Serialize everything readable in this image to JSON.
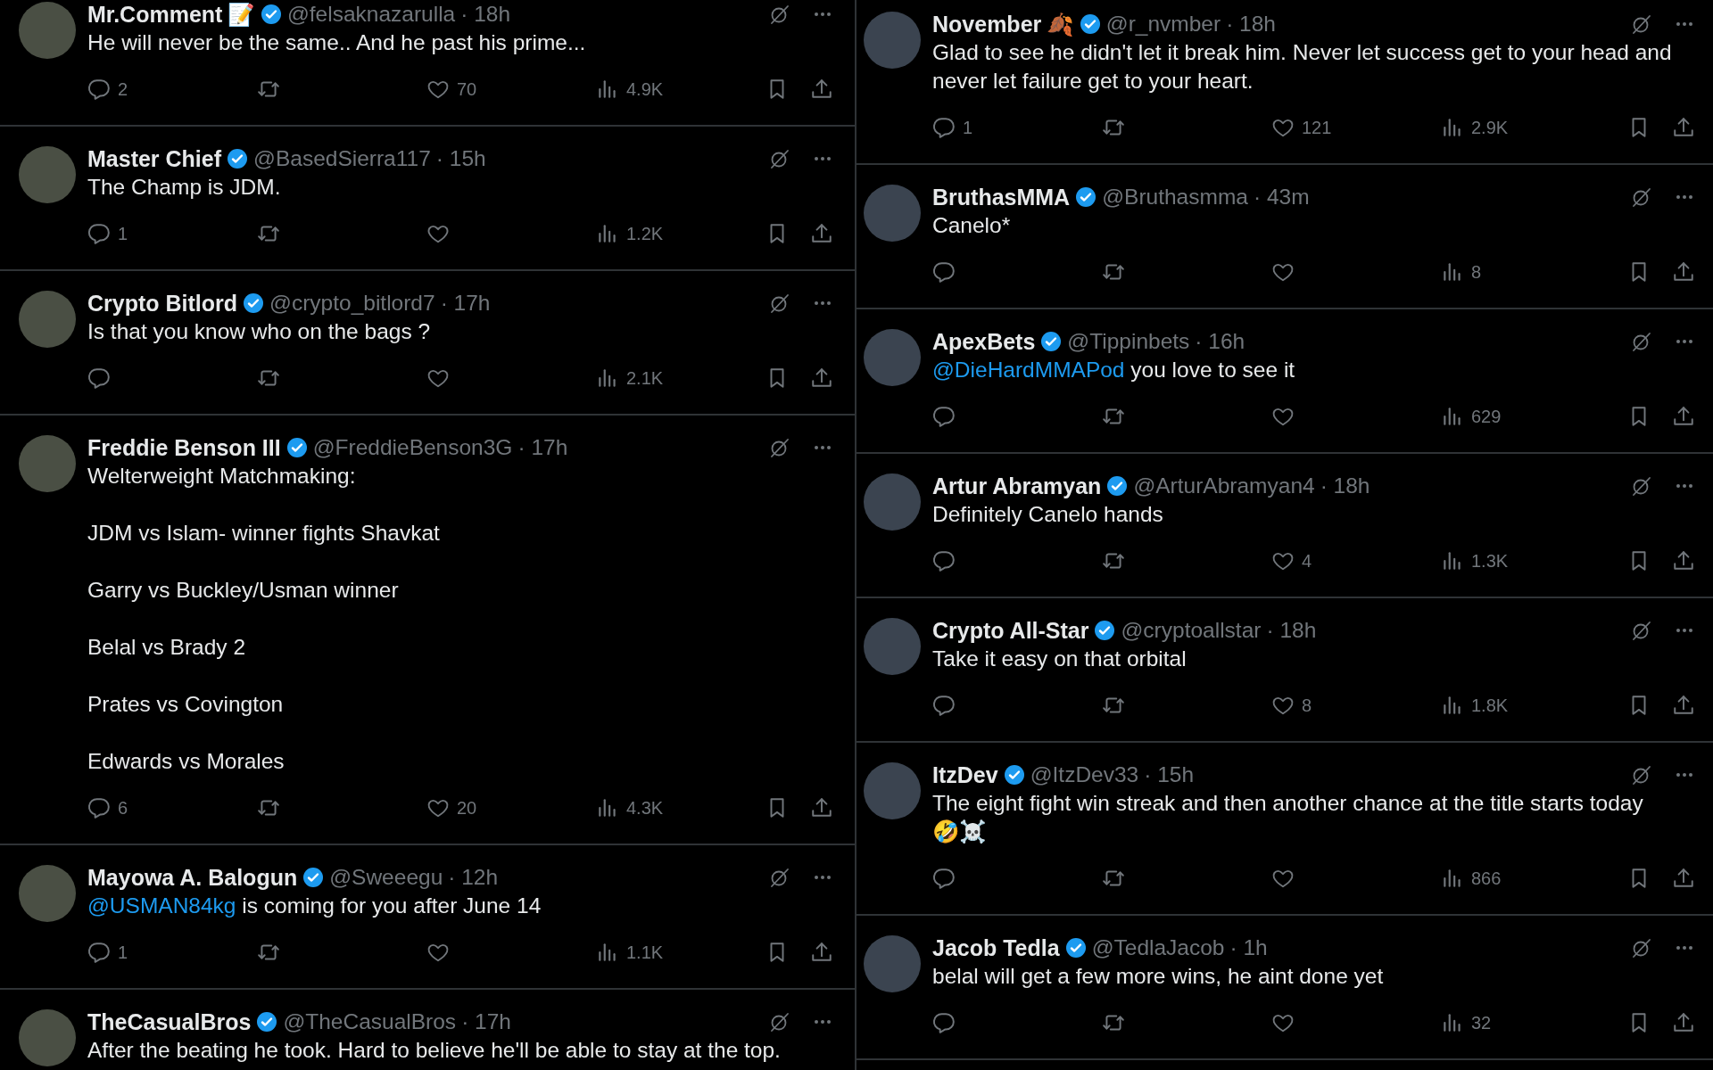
{
  "columns": [
    {
      "tweets": [
        {
          "name": "Mr.Comment",
          "name_emoji": "📝",
          "verified": true,
          "handle": "@felsaknazarulla",
          "time": "· 18h",
          "body": [
            {
              "text": "He will never be the same.. And he past his prime..."
            }
          ],
          "stats": {
            "replies": "2",
            "likes": "70",
            "views": "4.9K"
          }
        },
        {
          "name": "Master Chief",
          "verified": true,
          "handle": "@BasedSierra117",
          "time": "· 15h",
          "body": [
            {
              "text": "The Champ is JDM."
            }
          ],
          "stats": {
            "replies": "1",
            "views": "1.2K"
          }
        },
        {
          "name": "Crypto Bitlord",
          "verified": true,
          "handle": "@crypto_bitlord7",
          "time": "· 17h",
          "body": [
            {
              "text": "Is that you know who on the bags ?"
            }
          ],
          "stats": {
            "views": "2.1K"
          }
        },
        {
          "name": "Freddie Benson III",
          "verified": true,
          "handle": "@FreddieBenson3G",
          "time": "· 17h",
          "body": [
            {
              "text": "Welterweight Matchmaking:"
            },
            {
              "text": "JDM vs Islam- winner fights Shavkat"
            },
            {
              "text": "Garry vs Buckley/Usman winner"
            },
            {
              "text": "Belal vs Brady 2"
            },
            {
              "text": "Prates vs Covington"
            },
            {
              "text": "Edwards vs Morales"
            }
          ],
          "stats": {
            "replies": "6",
            "likes": "20",
            "views": "4.3K"
          }
        },
        {
          "name": "Mayowa A. Balogun",
          "verified": true,
          "handle": "@Sweeegu",
          "time": "· 12h",
          "body": [
            {
              "mention": "@USMAN84kg",
              "text": " is coming for you after June 14"
            }
          ],
          "stats": {
            "replies": "1",
            "views": "1.1K"
          }
        },
        {
          "name": "TheCasualBros",
          "verified": true,
          "handle": "@TheCasualBros",
          "time": "· 17h",
          "body": [
            {
              "text": "After the beating he took. Hard to believe he'll be able to stay at the top."
            }
          ]
        }
      ]
    },
    {
      "tweets": [
        {
          "name": "November",
          "name_emoji": "🍂",
          "verified": true,
          "handle": "@r_nvmber",
          "time": "· 18h",
          "body": [
            {
              "text": "Glad to see he didn't let it break him. Never let success get to your head and never let failure get to your heart."
            }
          ],
          "stats": {
            "replies": "1",
            "likes": "121",
            "views": "2.9K"
          }
        },
        {
          "name": "BruthasMMA",
          "verified": true,
          "handle": "@Bruthasmma",
          "time": "· 43m",
          "body": [
            {
              "text": "Canelo*"
            }
          ],
          "stats": {
            "views": "8"
          }
        },
        {
          "name": "ApexBets",
          "verified": true,
          "handle": "@Tippinbets",
          "time": "· 16h",
          "body": [
            {
              "mention": "@DieHardMMAPod",
              "text": " you love to see it"
            }
          ],
          "stats": {
            "views": "629"
          }
        },
        {
          "name": "Artur Abramyan",
          "verified": true,
          "handle": "@ArturAbramyan4",
          "time": "· 18h",
          "body": [
            {
              "text": "Definitely Canelo hands"
            }
          ],
          "stats": {
            "likes": "4",
            "views": "1.3K"
          }
        },
        {
          "name": "Crypto All-Star",
          "verified": true,
          "handle": "@cryptoallstar",
          "time": "· 18h",
          "body": [
            {
              "text": "Take it easy on that orbital"
            }
          ],
          "stats": {
            "likes": "8",
            "views": "1.8K"
          }
        },
        {
          "name": "ItzDev",
          "verified": true,
          "handle": "@ItzDev33",
          "time": "· 15h",
          "body": [
            {
              "text": "The eight fight win streak and then another chance at the title starts today",
              "emoji_line": "🤣☠️"
            }
          ],
          "stats": {
            "views": "866"
          }
        },
        {
          "name": "Jacob Tedla",
          "verified": true,
          "handle": "@TedlaJacob",
          "time": "· 1h",
          "body": [
            {
              "text": "belal will get a few more wins, he aint done yet"
            }
          ],
          "stats": {
            "views": "32"
          }
        }
      ]
    }
  ]
}
